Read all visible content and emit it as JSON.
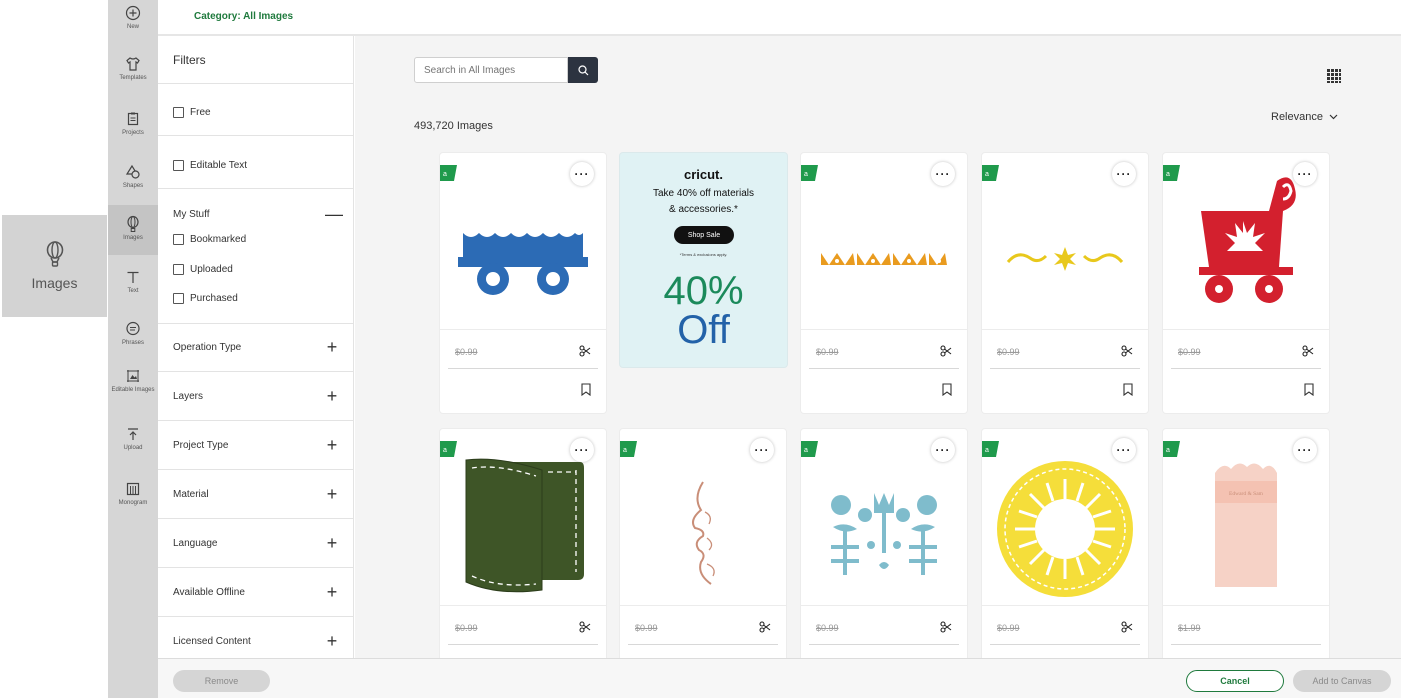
{
  "callout": {
    "icon": "balloon-icon",
    "label": "Images"
  },
  "rail": {
    "items": [
      {
        "icon": "plus-circle-icon",
        "label": "New"
      },
      {
        "icon": "tshirt-icon",
        "label": "Templates"
      },
      {
        "icon": "project-icon",
        "label": "Projects"
      },
      {
        "icon": "shapes-icon",
        "label": "Shapes"
      },
      {
        "icon": "balloon-icon",
        "label": "Images",
        "active": true
      },
      {
        "icon": "text-icon",
        "label": "Text"
      },
      {
        "icon": "speech-bubble-icon",
        "label": "Phrases"
      },
      {
        "icon": "editable-images-icon",
        "label": "Editable Images"
      },
      {
        "icon": "upload-icon",
        "label": "Upload"
      },
      {
        "icon": "monogram-icon",
        "label": "Monogram"
      }
    ]
  },
  "header": {
    "category": "Category: All Images"
  },
  "filters": {
    "title": "Filters",
    "free": "Free",
    "editable_text": "Editable Text",
    "my_stuff": {
      "label": "My Stuff",
      "toggle": "—",
      "items": [
        "Bookmarked",
        "Uploaded",
        "Purchased"
      ]
    },
    "sections": [
      {
        "label": "Operation Type",
        "toggle": "+"
      },
      {
        "label": "Layers",
        "toggle": "+"
      },
      {
        "label": "Project Type",
        "toggle": "+"
      },
      {
        "label": "Material",
        "toggle": "+"
      },
      {
        "label": "Language",
        "toggle": "+"
      },
      {
        "label": "Available Offline",
        "toggle": "+"
      },
      {
        "label": "Licensed Content",
        "toggle": "+"
      }
    ]
  },
  "search": {
    "placeholder": "Search in All Images"
  },
  "results": {
    "count": "493,720 Images",
    "sort": "Relevance"
  },
  "promo": {
    "brand": "cricut.",
    "line1": "Take 40% off materials",
    "line2": "& accessories.*",
    "button": "Shop Sale",
    "terms": "*Terms & exclusions apply.",
    "big1": "40%",
    "big2": "Off"
  },
  "cards": [
    {
      "art": "blue-wagon",
      "price": "$0.99",
      "bookmark": true
    },
    {
      "art": "orange-border",
      "price": "$0.99",
      "bookmark": true
    },
    {
      "art": "yellow-flourish",
      "price": "$0.99",
      "bookmark": true
    },
    {
      "art": "red-sleigh",
      "price": "$0.99",
      "bookmark": true
    },
    {
      "art": "green-wallet",
      "price": "$0.99"
    },
    {
      "art": "face-profile",
      "price": "$0.99"
    },
    {
      "art": "blue-floral",
      "price": "$0.99"
    },
    {
      "art": "yellow-sunburst",
      "price": "$0.99"
    },
    {
      "art": "pink-tag",
      "price": "$1.99",
      "tag_text": "Edward & Sam"
    }
  ],
  "colors": {
    "brand_green": "#1f7a3d",
    "tag_green": "#1f9a4c",
    "wagon_blue": "#2c6bb5",
    "sleigh_red": "#d3202e",
    "wallet_green": "#3e5527"
  },
  "footer": {
    "remove": "Remove",
    "cancel": "Cancel",
    "add": "Add to Canvas"
  }
}
